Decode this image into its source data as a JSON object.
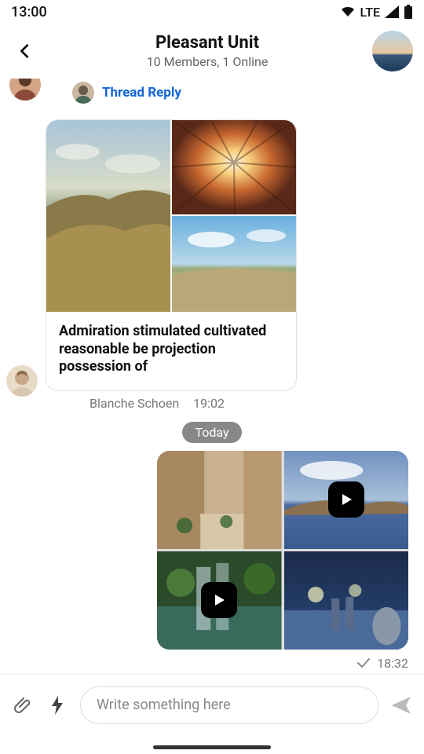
{
  "status": {
    "time": "13:00",
    "network": "LTE"
  },
  "header": {
    "title": "Pleasant Unit",
    "subtitle": "10 Members, 1 Online"
  },
  "thread": {
    "reply_label": "Thread Reply"
  },
  "message1": {
    "text": "Admiration stimulated cultivated reasonable be projection possession of",
    "sender": "Blanche Schoen",
    "time": "19:02"
  },
  "separator": {
    "label": "Today"
  },
  "message2": {
    "time": "18:32"
  },
  "composer": {
    "placeholder": "Write something here"
  }
}
